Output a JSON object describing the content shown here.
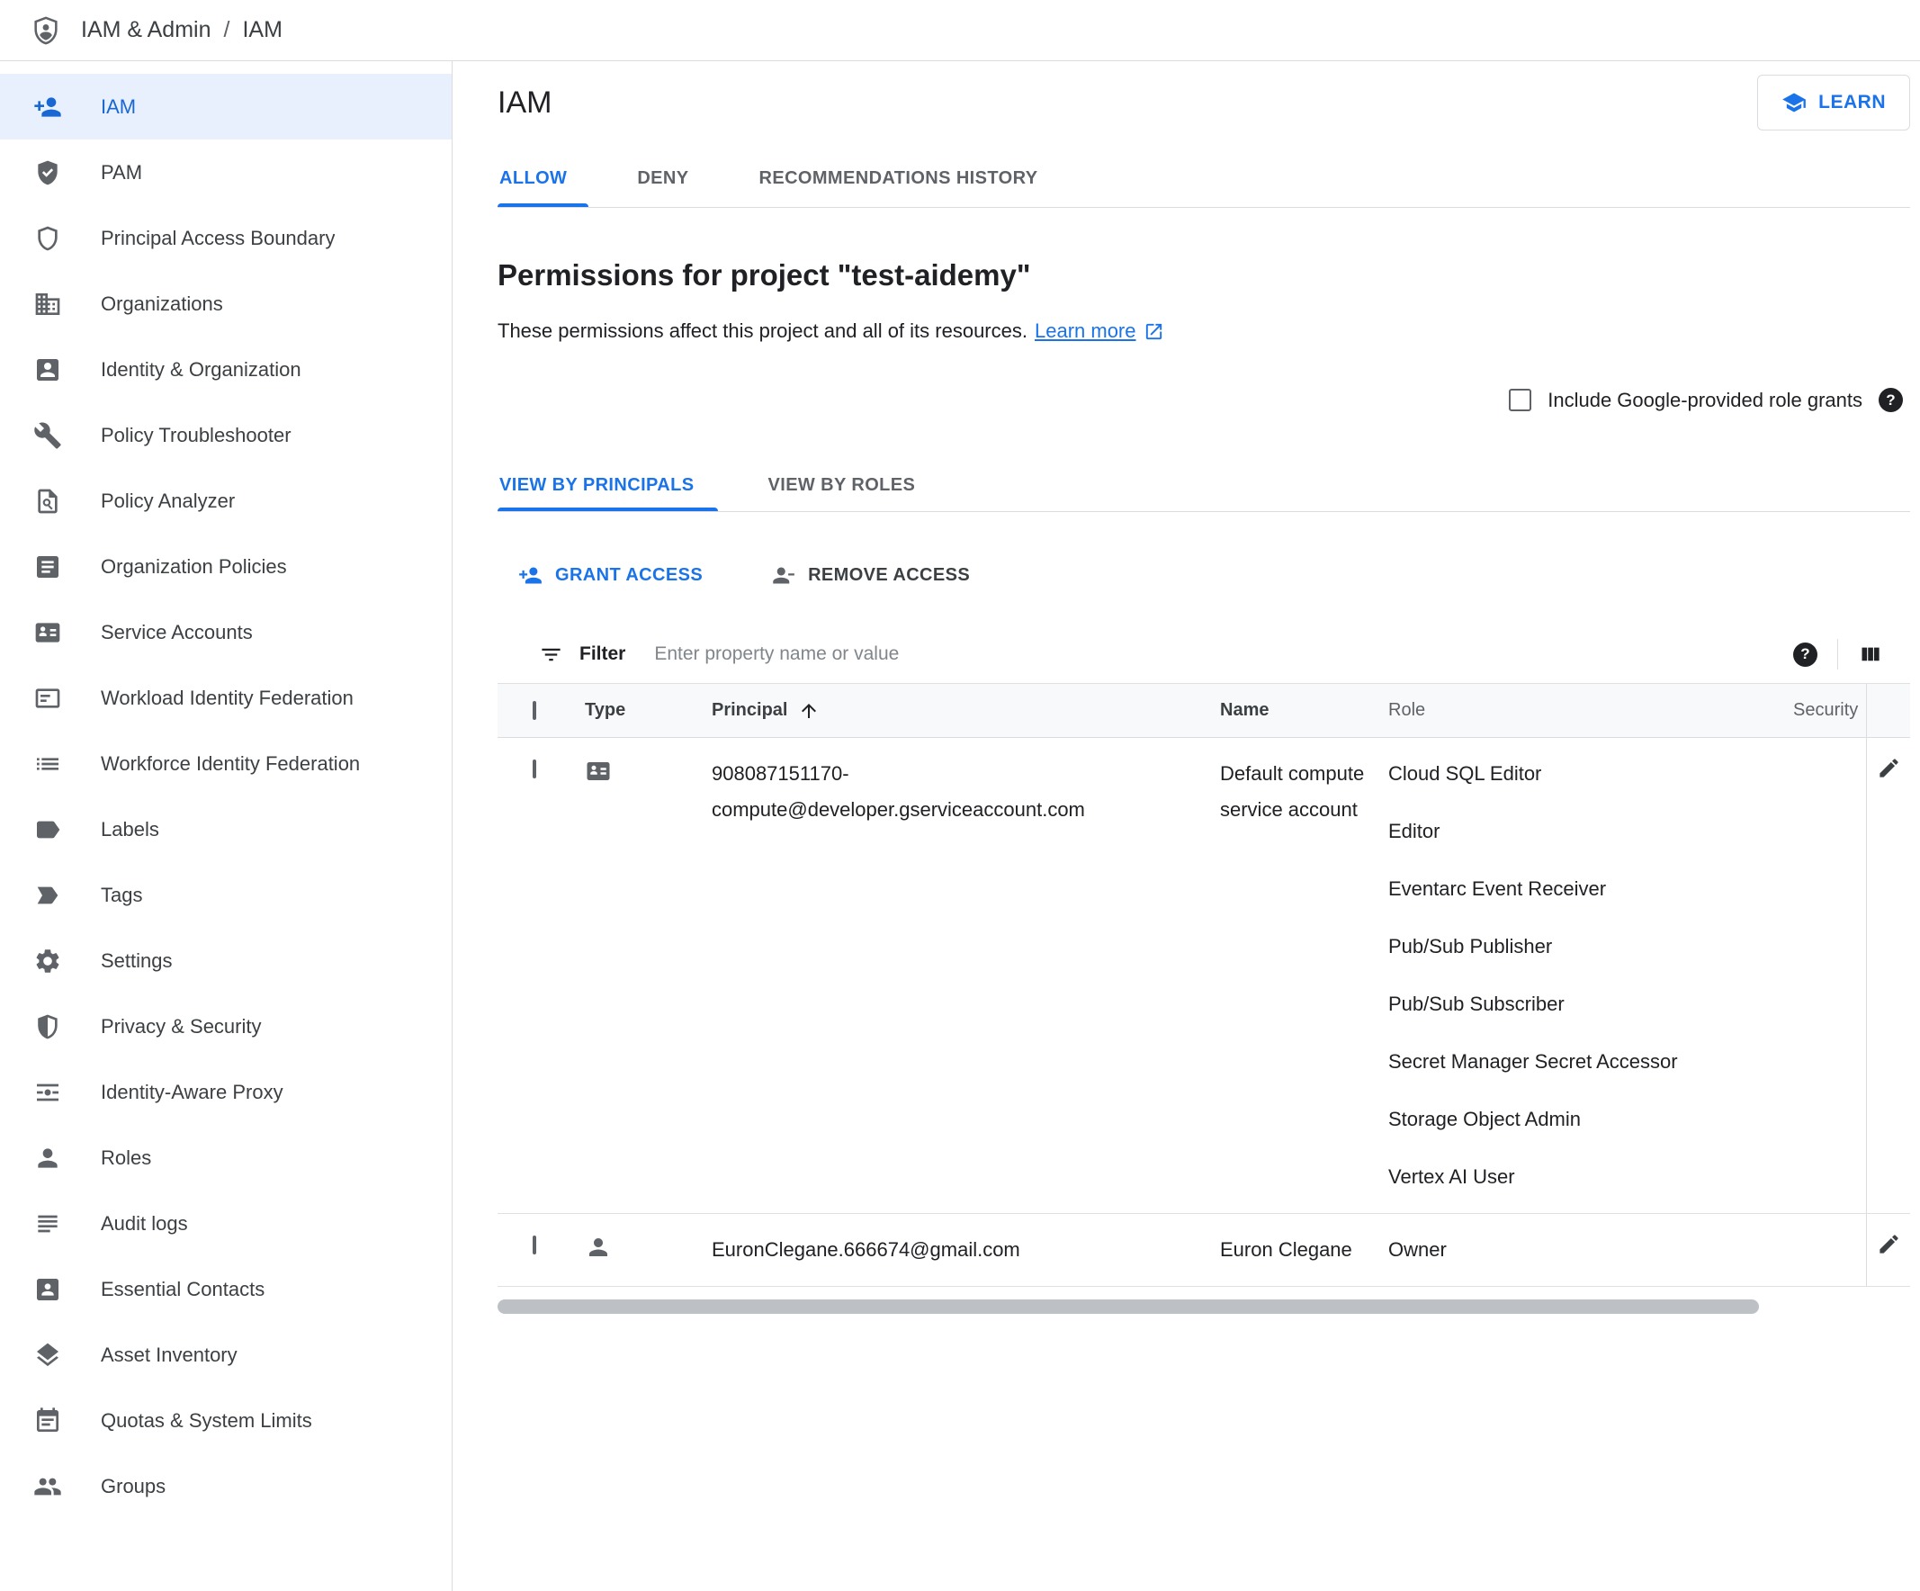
{
  "topbar": {
    "breadcrumb": {
      "section": "IAM & Admin",
      "separator": "/",
      "page": "IAM"
    }
  },
  "sidebar": {
    "items": [
      {
        "label": "IAM"
      },
      {
        "label": "PAM"
      },
      {
        "label": "Principal Access Boundary"
      },
      {
        "label": "Organizations"
      },
      {
        "label": "Identity & Organization"
      },
      {
        "label": "Policy Troubleshooter"
      },
      {
        "label": "Policy Analyzer"
      },
      {
        "label": "Organization Policies"
      },
      {
        "label": "Service Accounts"
      },
      {
        "label": "Workload Identity Federation"
      },
      {
        "label": "Workforce Identity Federation"
      },
      {
        "label": "Labels"
      },
      {
        "label": "Tags"
      },
      {
        "label": "Settings"
      },
      {
        "label": "Privacy & Security"
      },
      {
        "label": "Identity-Aware Proxy"
      },
      {
        "label": "Roles"
      },
      {
        "label": "Audit logs"
      },
      {
        "label": "Essential Contacts"
      },
      {
        "label": "Asset Inventory"
      },
      {
        "label": "Quotas & System Limits"
      },
      {
        "label": "Groups"
      }
    ]
  },
  "main": {
    "title": "IAM",
    "learn_button": "LEARN",
    "tabs": {
      "allow": "ALLOW",
      "deny": "DENY",
      "recommendations": "RECOMMENDATIONS HISTORY"
    },
    "heading": "Permissions for project \"test-aidemy\"",
    "description": "These permissions affect this project and all of its resources.",
    "learn_more": "Learn more",
    "include_toggle": {
      "label": "Include Google-provided role grants"
    },
    "view_tabs": {
      "principals": "VIEW BY PRINCIPALS",
      "roles": "VIEW BY ROLES"
    },
    "actions": {
      "grant": "GRANT ACCESS",
      "remove": "REMOVE ACCESS"
    },
    "filter": {
      "label": "Filter",
      "placeholder": "Enter property name or value"
    },
    "table": {
      "headers": {
        "type": "Type",
        "principal": "Principal",
        "name": "Name",
        "role": "Role",
        "security": "Security"
      },
      "rows": [
        {
          "type": "service-account",
          "principal": "908087151170-compute@developer.gserviceaccount.com",
          "name": "Default compute service account",
          "roles": [
            "Cloud SQL Editor",
            "Editor",
            "Eventarc Event Receiver",
            "Pub/Sub Publisher",
            "Pub/Sub Subscriber",
            "Secret Manager Secret Accessor",
            "Storage Object Admin",
            "Vertex AI User"
          ]
        },
        {
          "type": "user",
          "principal": "EuronClegane.666674@gmail.com",
          "name": "Euron Clegane",
          "roles": [
            "Owner"
          ]
        }
      ]
    }
  },
  "icons": {
    "help": "?"
  },
  "colors": {
    "accent": "#1a73e8",
    "active_item_bg": "#e8f0fe",
    "active_item_fg": "#1967d2"
  }
}
